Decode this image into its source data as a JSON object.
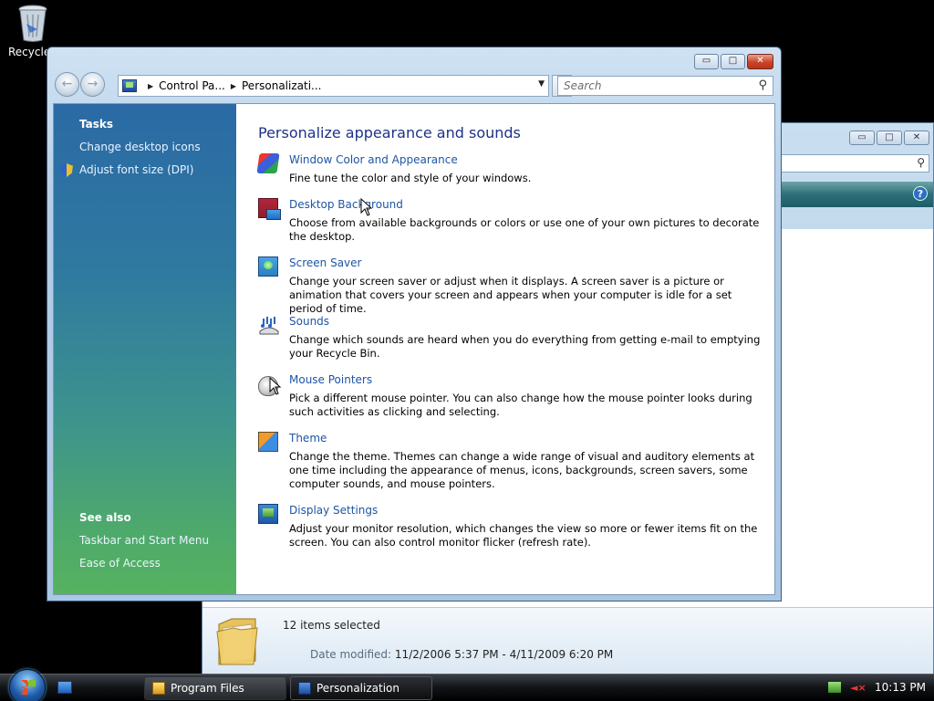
{
  "desktop": {
    "recycle_label": "Recycle"
  },
  "bg_window": {
    "details": {
      "selection_text": "12 items selected",
      "date_key": "Date modified:",
      "date_value": "11/2/2006 5:37 PM - 4/11/2009 6:20 PM"
    }
  },
  "window": {
    "breadcrumb": [
      "Control Pa...",
      "Personalizati..."
    ],
    "search_placeholder": "Search",
    "sidebar": {
      "tasks_heading": "Tasks",
      "tasks": [
        "Change desktop icons",
        "Adjust font size (DPI)"
      ],
      "see_also_heading": "See also",
      "see_also": [
        "Taskbar and Start Menu",
        "Ease of Access"
      ]
    },
    "main": {
      "title": "Personalize appearance and sounds",
      "items": [
        {
          "icon": "window-color-icon",
          "title": "Window Color and Appearance",
          "desc": "Fine tune the color and style of your windows."
        },
        {
          "icon": "desktop-background-icon",
          "title": "Desktop Background",
          "desc": "Choose from available backgrounds or colors or use one of your own pictures to decorate the desktop."
        },
        {
          "icon": "screen-saver-icon",
          "title": "Screen Saver",
          "desc": "Change your screen saver or adjust when it displays. A screen saver is a picture or animation that covers your screen and appears when your computer is idle for a set period of time."
        },
        {
          "icon": "sounds-icon",
          "title": "Sounds",
          "desc": "Change which sounds are heard when you do everything from getting e-mail to emptying your Recycle Bin."
        },
        {
          "icon": "mouse-pointer-icon",
          "title": "Mouse Pointers",
          "desc": "Pick a different mouse pointer. You can also change how the mouse pointer looks during such activities as clicking and selecting."
        },
        {
          "icon": "theme-icon",
          "title": "Theme",
          "desc": "Change the theme. Themes can change a wide range of visual and auditory elements at one time including the appearance of menus, icons, backgrounds, screen savers, some computer sounds, and mouse pointers."
        },
        {
          "icon": "display-settings-icon",
          "title": "Display Settings",
          "desc": "Adjust your monitor resolution, which changes the view so more or fewer items fit on the screen. You can also control monitor flicker (refresh rate)."
        }
      ]
    }
  },
  "taskbar": {
    "buttons": [
      {
        "label": "Program Files",
        "icon": "folder-icon",
        "active": false
      },
      {
        "label": "Personalization",
        "icon": "control-panel-icon",
        "active": true
      }
    ],
    "clock": "10:13 PM"
  }
}
